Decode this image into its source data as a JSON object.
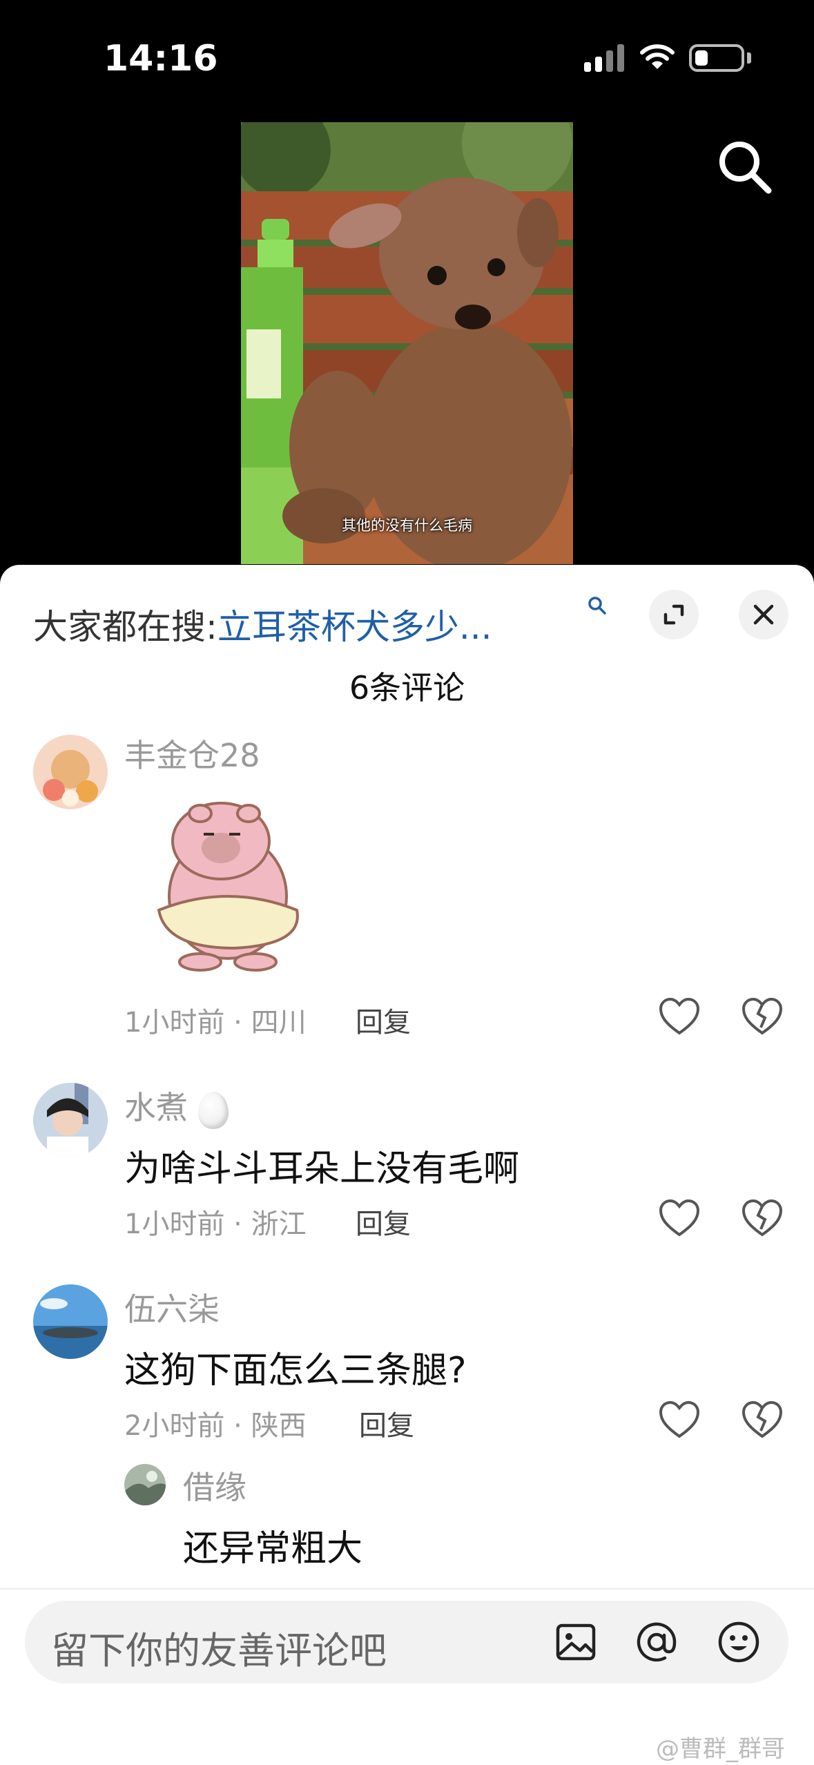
{
  "status": {
    "time": "14:16"
  },
  "video": {
    "subtitle": "其他的没有什么毛病"
  },
  "sheet": {
    "hot_prefix": "大家都在搜:",
    "hot_query": "立耳茶杯犬多少...",
    "comment_count": "6条评论"
  },
  "comments": [
    {
      "user": "丰金仓28",
      "text": "",
      "meta": "1小时前 · 四川",
      "reply": "回复"
    },
    {
      "user": "水煮",
      "text": "为啥斗斗耳朵上没有毛啊",
      "meta": "1小时前 · 浙江",
      "reply": "回复"
    },
    {
      "user": "伍六柒",
      "text": "这狗下面怎么三条腿?",
      "meta": "2小时前 · 陕西",
      "reply": "回复"
    }
  ],
  "subreply": {
    "user": "借缘",
    "text": "还异常粗大"
  },
  "input": {
    "placeholder": "留下你的友善评论吧"
  },
  "watermark": "@曹群_群哥",
  "colors": {
    "accent_link": "#1f5fa8",
    "sheet_bg": "#ffffff",
    "page_bg": "#000000"
  }
}
